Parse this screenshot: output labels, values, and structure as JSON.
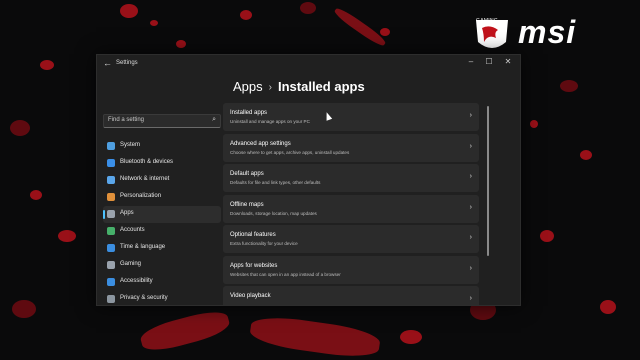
{
  "brand": {
    "text": "msi",
    "small": "GAMING"
  },
  "window": {
    "app_title": "Settings",
    "back": "←",
    "minimize": "–",
    "maximize": "☐",
    "close": "✕"
  },
  "breadcrumb": {
    "parent": "Apps",
    "separator": "›",
    "current": "Installed apps"
  },
  "search": {
    "placeholder": "Find a setting",
    "icon": "⌕"
  },
  "nav": [
    {
      "label": "System",
      "icon": "system-icon",
      "color": "#4f9fe0"
    },
    {
      "label": "Bluetooth & devices",
      "icon": "bluetooth-icon",
      "color": "#3a8fe8"
    },
    {
      "label": "Network & internet",
      "icon": "network-icon",
      "color": "#5aa6ea"
    },
    {
      "label": "Personalization",
      "icon": "brush-icon",
      "color": "#e0903a"
    },
    {
      "label": "Apps",
      "icon": "apps-icon",
      "color": "#9aa3ad"
    },
    {
      "label": "Accounts",
      "icon": "accounts-icon",
      "color": "#46b06a"
    },
    {
      "label": "Time & language",
      "icon": "clock-globe-icon",
      "color": "#3b8ee0"
    },
    {
      "label": "Gaming",
      "icon": "gaming-icon",
      "color": "#9aa3ad"
    },
    {
      "label": "Accessibility",
      "icon": "accessibility-icon",
      "color": "#3b8ee0"
    },
    {
      "label": "Privacy & security",
      "icon": "shield-icon",
      "color": "#8c96a0"
    }
  ],
  "cards": [
    {
      "title": "Installed apps",
      "desc": "Uninstall and manage apps on your PC"
    },
    {
      "title": "Advanced app settings",
      "desc": "Choose where to get apps, archive apps, uninstall updates"
    },
    {
      "title": "Default apps",
      "desc": "Defaults for file and link types, other defaults"
    },
    {
      "title": "Offline maps",
      "desc": "Downloads, storage location, map updates"
    },
    {
      "title": "Optional features",
      "desc": "Extra functionality for your device"
    },
    {
      "title": "Apps for websites",
      "desc": "Websites that can open in an app instead of a browser"
    },
    {
      "title": "Video playback",
      "desc": ""
    }
  ],
  "chevron": "›"
}
